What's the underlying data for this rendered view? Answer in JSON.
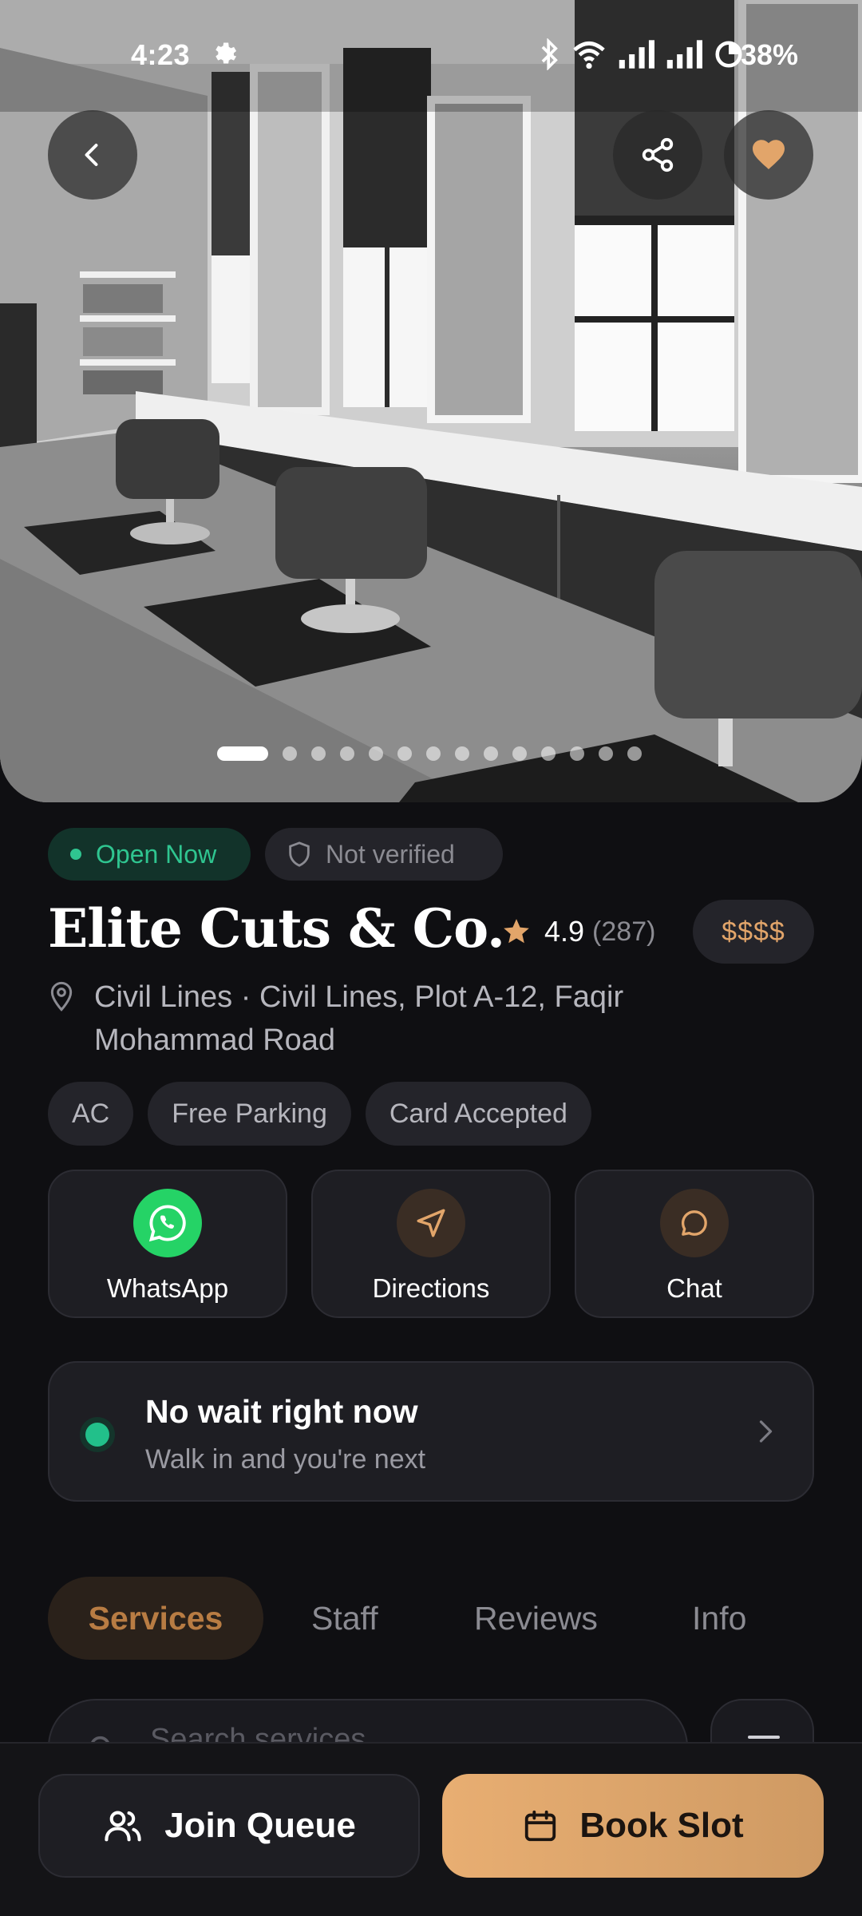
{
  "status_bar": {
    "time": "4:23",
    "battery": "38%",
    "icons": [
      "gear-icon",
      "bluetooth-icon",
      "wifi-icon",
      "signal-icon",
      "signal-icon",
      "battery-saver-icon"
    ]
  },
  "hero": {
    "image": "barbershop-interior-photo",
    "page_count": 15,
    "active_page": 1
  },
  "badges": {
    "open": "Open Now",
    "verified": "Not verified"
  },
  "shop": {
    "name": "Elite Cuts & Co.",
    "rating": "4.9",
    "reviews_count": "(287)",
    "price": "$$$$",
    "address": "Civil Lines · Civil Lines, Plot A-12, Faqir Mohammad Road"
  },
  "amenities": [
    "AC",
    "Free Parking",
    "Card Accepted"
  ],
  "contact": {
    "whatsapp": "WhatsApp",
    "directions": "Directions",
    "chat": "Chat"
  },
  "wait": {
    "title": "No wait right now",
    "subtitle": "Walk in and you're next"
  },
  "tabs": [
    "Services",
    "Staff",
    "Reviews",
    "Info"
  ],
  "search": {
    "placeholder": "Search services"
  },
  "actions": {
    "join_queue": "Join Queue",
    "book_slot": "Book Slot"
  },
  "colors": {
    "background": "#0f0f12",
    "card": "#1e1e23",
    "accent": "#e2a56a",
    "open_green": "#2fc590",
    "whatsapp": "#25d366"
  }
}
